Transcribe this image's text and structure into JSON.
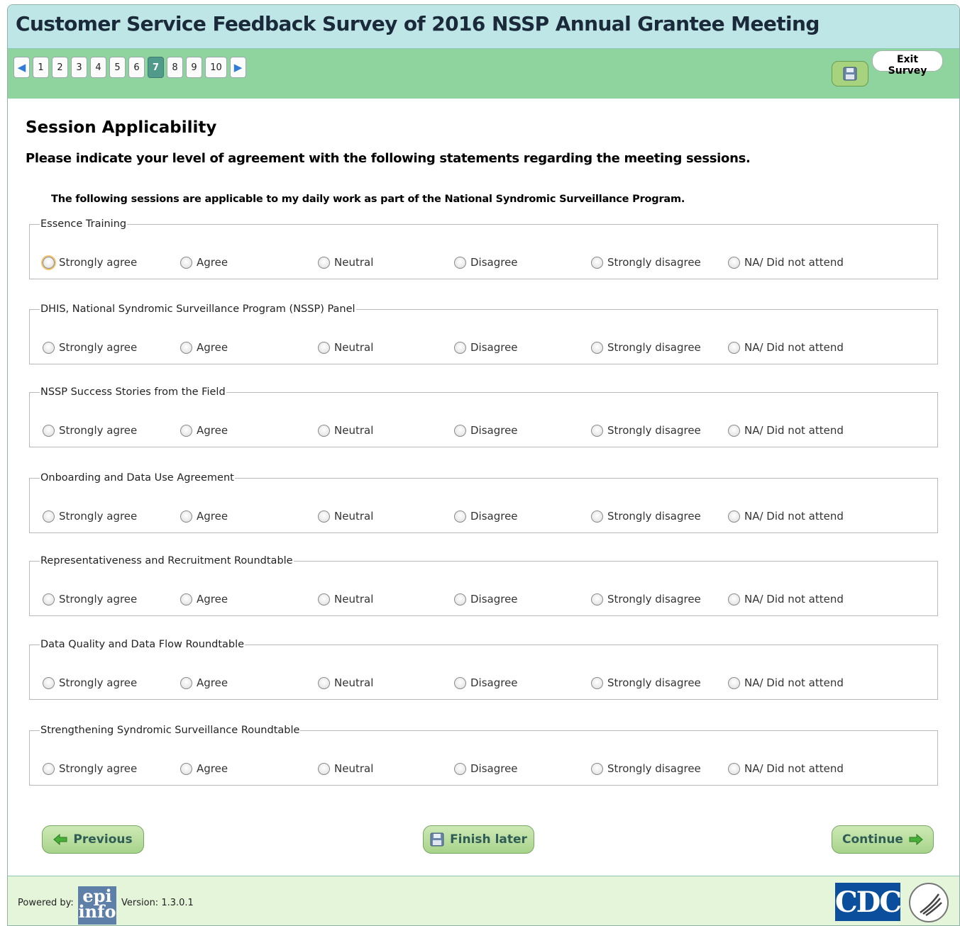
{
  "header": {
    "title": "Customer Service Feedback Survey of 2016 NSSP Annual Grantee Meeting"
  },
  "pagination": {
    "pages": [
      "1",
      "2",
      "3",
      "4",
      "5",
      "6",
      "7",
      "8",
      "9",
      "10"
    ],
    "current": "7"
  },
  "toolbar": {
    "exit_label_line1": "Exit",
    "exit_label_line2": "Survey"
  },
  "section": {
    "title": "Session Applicability",
    "instruction": "Please indicate your level of agreement with the following statements regarding the meeting sessions.",
    "question": "The following sessions are applicable to my daily work as part of the National Syndromic Surveillance Program."
  },
  "options": [
    "Strongly agree",
    "Agree",
    "Neutral",
    "Disagree",
    "Strongly disagree",
    "NA/ Did not attend"
  ],
  "sessions": [
    "Essence Training",
    "DHIS, National Syndromic Surveillance Program (NSSP) Panel",
    "NSSP Success Stories from the Field",
    "Onboarding and Data Use Agreement",
    "Representativeness and Recruitment Roundtable",
    "Data Quality and Data Flow Roundtable",
    "Strengthening Syndromic Surveillance Roundtable"
  ],
  "buttons": {
    "previous": "Previous",
    "finish_later": "Finish later",
    "continue": "Continue"
  },
  "footer": {
    "powered_by": "Powered by:",
    "epi_logo_line1": "epi",
    "epi_logo_line2": "info",
    "version": "Version: 1.3.0.1",
    "cdc_logo": "CDC"
  },
  "colors": {
    "title_bg": "#bfe6e6",
    "nav_bg": "#8fd49f",
    "button_bg": "#a8d38a",
    "footer_bg": "#e4f5d9",
    "current_page": "#4f9a8a"
  }
}
